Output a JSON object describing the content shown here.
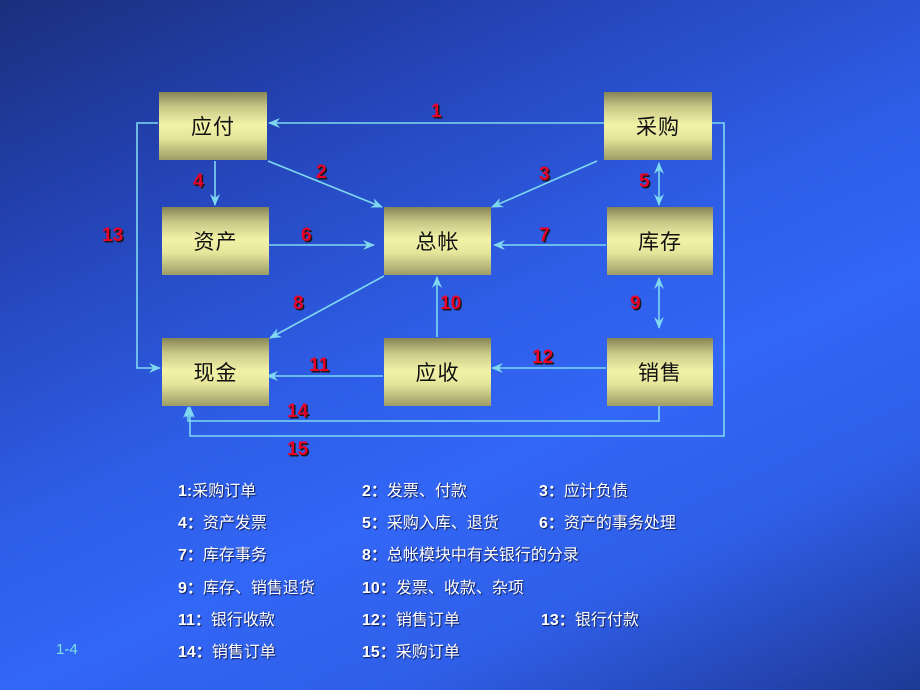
{
  "nodes": {
    "accounts_payable": "应付",
    "purchasing": "采购",
    "assets": "资产",
    "general_ledger": "总帐",
    "inventory": "库存",
    "cash": "现金",
    "accounts_receivable": "应收",
    "sales": "销售"
  },
  "flows": [
    {
      "id": "1",
      "from": "采购",
      "to": "应付"
    },
    {
      "id": "2",
      "from": "应付",
      "to": "总帐"
    },
    {
      "id": "3",
      "from": "采购",
      "to": "总帐"
    },
    {
      "id": "4",
      "from": "应付",
      "to": "资产"
    },
    {
      "id": "5",
      "from": "采购",
      "to": "库存",
      "bidirectional": true
    },
    {
      "id": "6",
      "from": "资产",
      "to": "总帐"
    },
    {
      "id": "7",
      "from": "库存",
      "to": "总帐"
    },
    {
      "id": "8",
      "from": "总帐",
      "to": "现金"
    },
    {
      "id": "9",
      "from": "库存",
      "to": "销售",
      "bidirectional": true
    },
    {
      "id": "10",
      "from": "应收",
      "to": "总帐"
    },
    {
      "id": "11",
      "from": "应收",
      "to": "现金"
    },
    {
      "id": "12",
      "from": "销售",
      "to": "应收"
    },
    {
      "id": "13",
      "from": "应付",
      "to": "现金"
    },
    {
      "id": "14",
      "from": "销售",
      "to": "现金"
    },
    {
      "id": "15",
      "from": "采购",
      "to": "现金"
    }
  ],
  "legend": [
    {
      "num": "1:",
      "text": "采购订单"
    },
    {
      "num": "2：",
      "text": "发票、付款"
    },
    {
      "num": "3：",
      "text": "应计负债"
    },
    {
      "num": "4：",
      "text": "资产发票"
    },
    {
      "num": "5：",
      "text": "采购入库、退货"
    },
    {
      "num": "6：",
      "text": "资产的事务处理"
    },
    {
      "num": "7：",
      "text": "库存事务"
    },
    {
      "num": "8：",
      "text": "总帐模块中有关银行的分录"
    },
    {
      "num": "9：",
      "text": "库存、销售退货"
    },
    {
      "num": "10：",
      "text": "发票、收款、杂项"
    },
    {
      "num": "11：",
      "text": "银行收款"
    },
    {
      "num": "12：",
      "text": "销售订单"
    },
    {
      "num": "13：",
      "text": "银行付款"
    },
    {
      "num": "14：",
      "text": "销售订单"
    },
    {
      "num": "15：",
      "text": "采购订单"
    }
  ],
  "page_number": "1-4",
  "colors": {
    "arrow": "#7fd8f0",
    "flow_number": "#e8002a",
    "node_fill": "#f2f3a7"
  }
}
